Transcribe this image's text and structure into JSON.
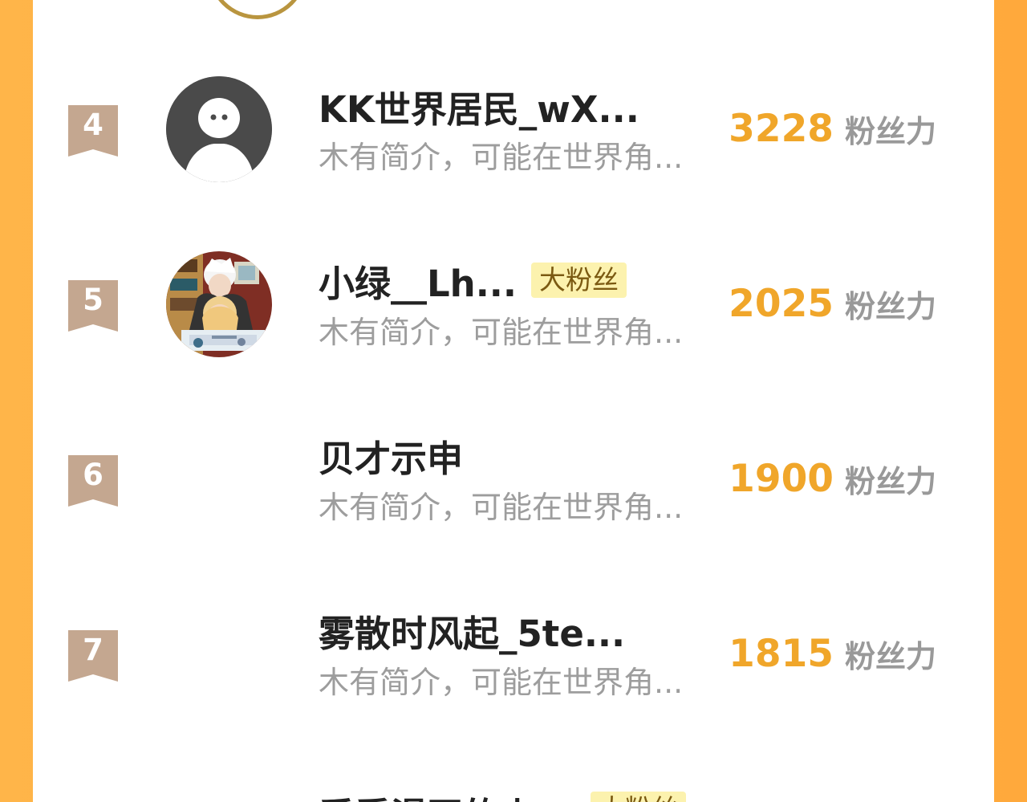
{
  "page": {
    "accent_color": "#f0a62a",
    "border_color": "#ffaf43"
  },
  "ranking": [
    {
      "rank": "4",
      "name": "KK世界居民_wX...",
      "bio": "木有简介，可能在世界角...",
      "score": "3228",
      "score_label": "粉丝力",
      "avatar": "default-user-avatar",
      "tag": ""
    },
    {
      "rank": "5",
      "name": "小绿__Lh...",
      "bio": "木有简介，可能在世界角...",
      "score": "2025",
      "score_label": "粉丝力",
      "avatar": "anime-avatar",
      "tag": "大粉丝"
    },
    {
      "rank": "6",
      "name": "贝才示申",
      "bio": "木有简介，可能在世界角...",
      "score": "1900",
      "score_label": "粉丝力",
      "avatar": "",
      "tag": ""
    },
    {
      "rank": "7",
      "name": "雾散时风起_5te...",
      "bio": "木有简介，可能在世界角...",
      "score": "1815",
      "score_label": "粉丝力",
      "avatar": "",
      "tag": ""
    }
  ],
  "partial_next": {
    "name": "爱看漫画的小",
    "tag": "大粉丝"
  }
}
